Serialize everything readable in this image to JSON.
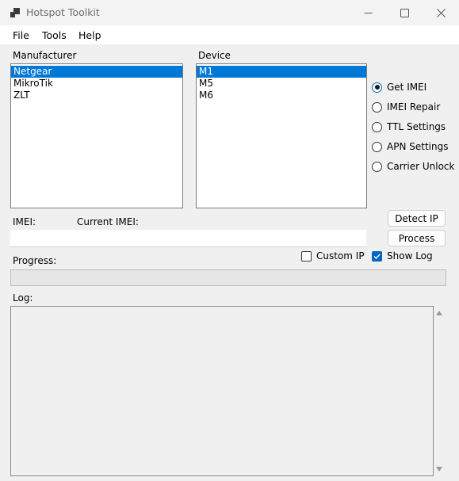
{
  "window": {
    "title": "Hotspot Toolkit"
  },
  "menu": {
    "items": [
      "File",
      "Tools",
      "Help"
    ]
  },
  "manufacturer": {
    "label": "Manufacturer",
    "items": [
      "Netgear",
      "MikroTik",
      "ZLT"
    ],
    "selected": "Netgear"
  },
  "device": {
    "label": "Device",
    "items": [
      "M1",
      "M5",
      "M6"
    ],
    "selected": "M1"
  },
  "operations": {
    "options": [
      "Get IMEI",
      "IMEI Repair",
      "TTL Settings",
      "APN Settings",
      "Carrier Unlock"
    ],
    "selected": "Get IMEI"
  },
  "imei": {
    "label": "IMEI:",
    "current_label": "Current IMEI:",
    "value": ""
  },
  "buttons": {
    "detect_ip": "Detect IP",
    "process": "Process"
  },
  "checkboxes": {
    "custom_ip": {
      "label": "Custom IP",
      "checked": false
    },
    "show_log": {
      "label": "Show Log",
      "checked": true
    }
  },
  "progress": {
    "label": "Progress:",
    "value": 0
  },
  "log": {
    "label": "Log:",
    "text": ""
  },
  "colors": {
    "selection": "#0078d7",
    "accent": "#0067c0",
    "window_bg": "#f0f0f0"
  },
  "icons": {
    "app": "app-window-icon",
    "minimize": "minimize-icon",
    "maximize": "maximize-icon",
    "close": "close-icon"
  }
}
